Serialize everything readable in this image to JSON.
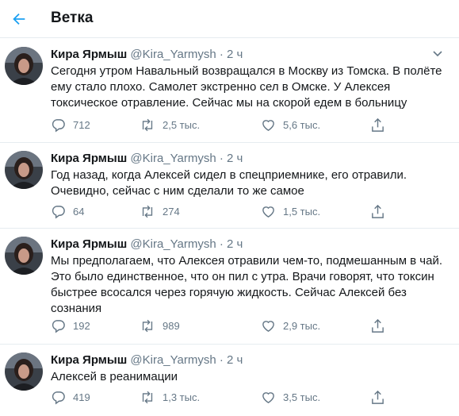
{
  "header": {
    "title": "Ветка"
  },
  "tweets": [
    {
      "name": "Кира Ярмыш",
      "handle": "@Kira_Yarmysh",
      "dot": "·",
      "time": "2 ч",
      "text": "Сегодня утром Навальный возвращался в Москву из Томска. В полёте ему стало плохо. Самолет экстренно сел в Омске. У Алексея токсическое отравление. Сейчас мы на скорой едем в больницу",
      "replies": "712",
      "retweets": "2,5 тыс.",
      "likes": "5,6 тыс."
    },
    {
      "name": "Кира Ярмыш",
      "handle": "@Kira_Yarmysh",
      "dot": "·",
      "time": "2 ч",
      "text": "Год назад, когда Алексей сидел в спецприемнике, его отравили. Очевидно, сейчас с ним сделали то же самое",
      "replies": "64",
      "retweets": "274",
      "likes": "1,5 тыс."
    },
    {
      "name": "Кира Ярмыш",
      "handle": "@Kira_Yarmysh",
      "dot": "·",
      "time": "2 ч",
      "text": "Мы предполагаем, что Алексея отравили чем-то, подмешанным в чай. Это было единственное, что он пил с утра. Врачи говорят, что токсин быстрее всосался через горячую жидкость. Сейчас Алексей без сознания",
      "replies": "192",
      "retweets": "989",
      "likes": "2,9 тыс."
    },
    {
      "name": "Кира Ярмыш",
      "handle": "@Kira_Yarmysh",
      "dot": "·",
      "time": "2 ч",
      "text": "Алексей в реанимации",
      "replies": "419",
      "retweets": "1,3 тыс.",
      "likes": "3,5 тыс."
    }
  ],
  "icons": {
    "back": "arrow-left-icon",
    "caret": "chevron-down-icon",
    "reply": "reply-bubble-icon",
    "retweet": "retweet-icon",
    "like": "heart-icon",
    "share": "share-icon"
  },
  "colors": {
    "accent": "#1da1f2",
    "secondary_text": "#657786",
    "divider": "#e6ecf0"
  }
}
